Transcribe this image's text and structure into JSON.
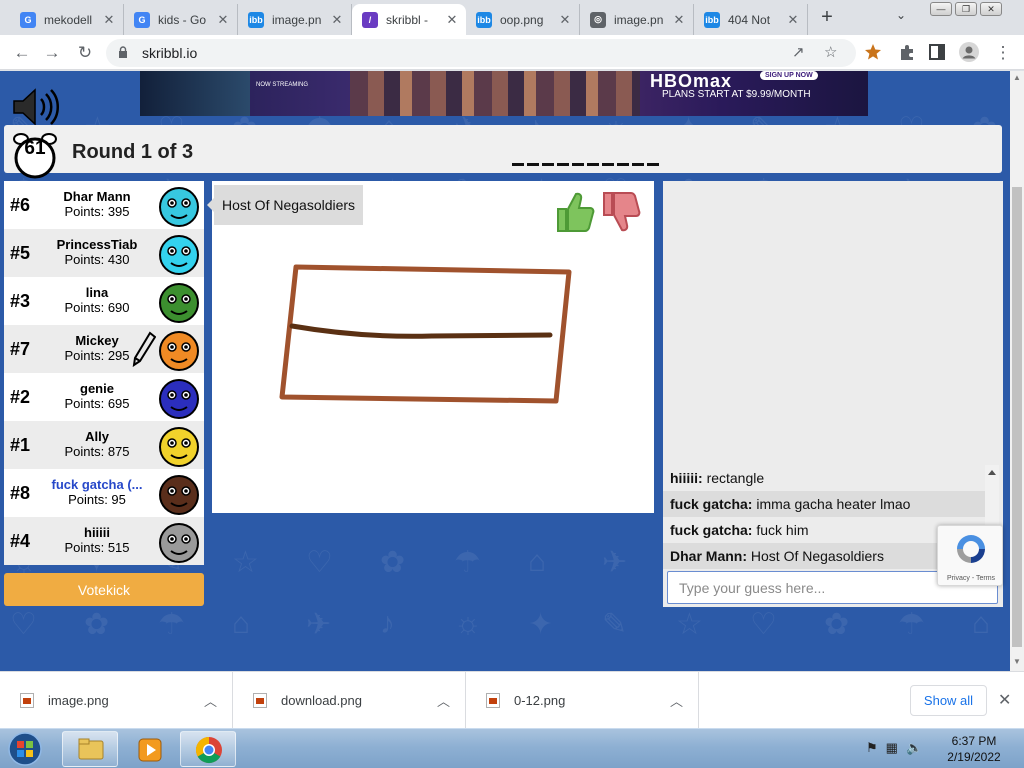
{
  "tabs": [
    {
      "title": "mekodell",
      "favicon": "google-icon",
      "color": "#4285f4",
      "glyph": "G"
    },
    {
      "title": "kids - Go",
      "favicon": "google-icon",
      "color": "#4285f4",
      "glyph": "G"
    },
    {
      "title": "image.pn",
      "favicon": "ibb-icon",
      "color": "#1e88e5",
      "glyph": "ibb"
    },
    {
      "title": "skribbl - ",
      "favicon": "skribbl-icon",
      "color": "#6a3cc2",
      "glyph": "/",
      "active": true
    },
    {
      "title": "oop.png",
      "favicon": "ibb-icon",
      "color": "#1e88e5",
      "glyph": "ibb"
    },
    {
      "title": "image.pn",
      "favicon": "globe-icon",
      "color": "#5f6368",
      "glyph": "◎"
    },
    {
      "title": "404 Not",
      "favicon": "ibb-icon",
      "color": "#1e88e5",
      "glyph": "ibb"
    }
  ],
  "new_tab_glyph": "+",
  "tab_search_glyph": "⌄",
  "address": {
    "url": "skribbl.io"
  },
  "nav": {
    "back": "←",
    "forward": "→",
    "reload": "↻",
    "share": "↗",
    "bookmark": "☆",
    "menu": "⋮"
  },
  "ad": {
    "brand": "HBOmax",
    "signup": "SIGN UP NOW",
    "plans": "PLANS START AT $9.99/MONTH",
    "streaming": "NOW STREAMING"
  },
  "game": {
    "timer": "61",
    "round": "Round 1 of 3",
    "word_blank_count": 10,
    "speaker_icon": "speaker-icon"
  },
  "players": [
    {
      "rank": "#6",
      "name": "Dhar Mann",
      "points": "Points: 395",
      "avatar_color": "#37c8e0"
    },
    {
      "rank": "#5",
      "name": "PrincessTiab",
      "points": "Points: 430",
      "avatar_color": "#33d2ee"
    },
    {
      "rank": "#3",
      "name": "lina",
      "points": "Points: 690",
      "avatar_color": "#3c8f2f"
    },
    {
      "rank": "#7",
      "name": "Mickey",
      "points": "Points: 295",
      "avatar_color": "#f08a24",
      "drawing": true
    },
    {
      "rank": "#2",
      "name": "genie",
      "points": "Points: 695",
      "avatar_color": "#2b2ebd"
    },
    {
      "rank": "#1",
      "name": "Ally",
      "points": "Points: 875",
      "avatar_color": "#f1d22b"
    },
    {
      "rank": "#8",
      "name": "fuck gatcha (...",
      "points": "Points: 95",
      "avatar_color": "#5a2e1b",
      "me": true
    },
    {
      "rank": "#4",
      "name": "hiiiii",
      "points": "Points: 515",
      "avatar_color": "#9a9a9a"
    }
  ],
  "votekick_label": "Votekick",
  "canvas": {
    "bubble_text": "Host Of Negasoldiers",
    "stroke_color": "#a0522d",
    "line_color": "#5a3013"
  },
  "chat": {
    "messages": [
      {
        "author": "hiiiii:",
        "text": "rectangle"
      },
      {
        "author": "fuck gatcha:",
        "text": "imma gacha heater lmao"
      },
      {
        "author": "fuck gatcha:",
        "text": "fuck him"
      },
      {
        "author": "Dhar Mann:",
        "text": "Host Of Negasoldiers"
      }
    ],
    "placeholder": "Type your guess here..."
  },
  "recaptcha": {
    "text": "Privacy - Terms"
  },
  "downloads": {
    "items": [
      {
        "name": "image.png"
      },
      {
        "name": "download.png"
      },
      {
        "name": "0-12.png"
      }
    ],
    "show_all": "Show all"
  },
  "taskbar": {
    "time": "6:37 PM",
    "date": "2/19/2022"
  },
  "colors": {
    "page_bg": "#2c5aa8",
    "accent_orange": "#f0ac42"
  }
}
